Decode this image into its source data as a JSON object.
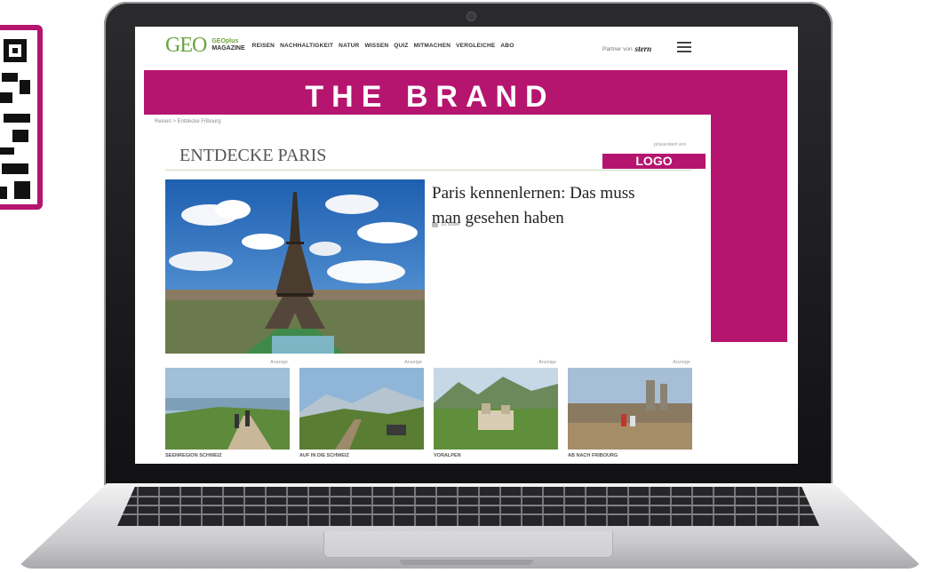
{
  "colors": {
    "brand": "#b5146f",
    "geo_green": "#6aa33e"
  },
  "site": {
    "logo": "GEO",
    "plus_line1": "GEOplus",
    "plus_line2": "MAGAZINE",
    "nav": [
      "REISEN",
      "NACHHALTIGKEIT",
      "NATUR",
      "WISSEN",
      "QUIZ",
      "MITMACHEN",
      "VERGLEICHE",
      "ABO"
    ],
    "partner_label": "Partner von",
    "partner_name": "stern",
    "menu_icon": "hamburger-icon"
  },
  "overlay": {
    "brand_text": "THE BRAND",
    "logo_text": "LOGO"
  },
  "page": {
    "breadcrumb": "Reisen > Entdecke Fribourg",
    "presented_by": "präsentiert von",
    "section_title": "ENTDECKE PARIS",
    "headline": "Paris kennenlernen: Das muss man gesehen haben",
    "photo_count": "10 Bilder"
  },
  "cards": [
    {
      "ad": "Anzeige",
      "caption": "SEENREGION SCHWEIZ"
    },
    {
      "ad": "Anzeige",
      "caption": "AUF IN DIE SCHWEIZ"
    },
    {
      "ad": "Anzeige",
      "caption": "VORALPEN"
    },
    {
      "ad": "Anzeige",
      "caption": "AB NACH FRIBOURG"
    }
  ]
}
